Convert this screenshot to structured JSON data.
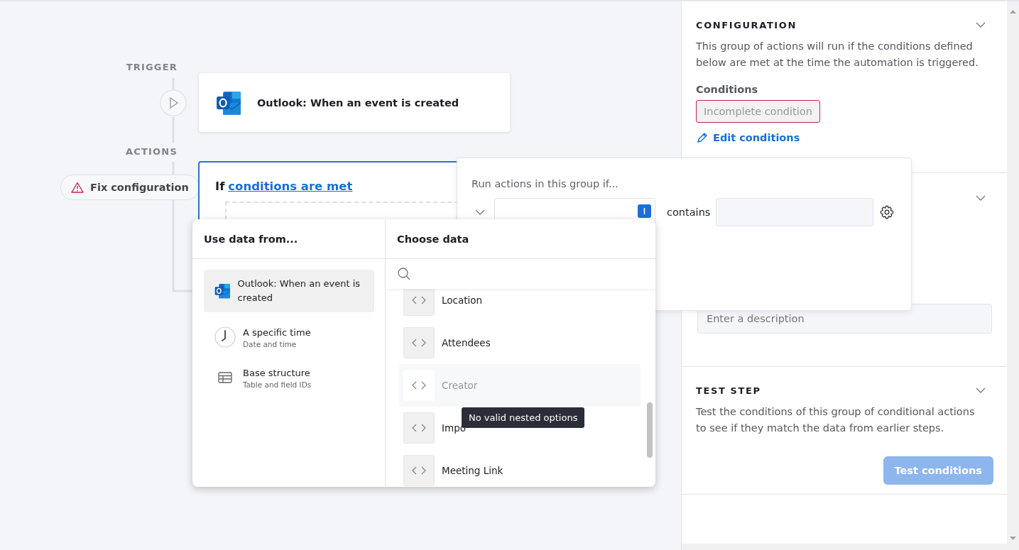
{
  "canvas": {
    "trigger_label": "TRIGGER",
    "trigger": {
      "title": "Outlook: When an event is created"
    },
    "actions_label": "ACTIONS",
    "fix_button": "Fix configuration",
    "condition_card": {
      "prefix": "If",
      "link": "conditions are met"
    }
  },
  "side_panel": {
    "sections": [
      {
        "kind": "config",
        "title": "CONFIGURATION",
        "description": "This group of actions will run if the conditions defined below are met at the time the automation is triggered.",
        "conditions_label": "Conditions",
        "condition_pill": "Incomplete condition",
        "edit_link": "Edit conditions"
      },
      {
        "kind": "details",
        "description_field": {
          "placeholder": "Enter a description"
        }
      },
      {
        "kind": "test",
        "title": "TEST STEP",
        "description": "Test the conditions of this group of conditional actions to see if they match the data from earlier steps.",
        "button": {
          "label": "Test conditions",
          "disabled": true
        }
      }
    ]
  },
  "condition_popover": {
    "heading": "Run actions in this group if...",
    "operator": "contains"
  },
  "data_picker": {
    "sources_heading": "Use data from...",
    "sources": [
      {
        "kind": "outlook",
        "title": "Outlook: When an event is created",
        "selected": true
      },
      {
        "kind": "clock",
        "title": "A specific time",
        "subtitle": "Date and time",
        "selected": false
      },
      {
        "kind": "table",
        "title": "Base structure",
        "subtitle": "Table and field IDs",
        "selected": false
      }
    ],
    "fields_heading": "Choose data",
    "fields": [
      {
        "label": "Location",
        "disabled": false
      },
      {
        "label": "Attendees",
        "disabled": false
      },
      {
        "label": "Creator",
        "disabled": true
      },
      {
        "label": "Impo",
        "disabled": false
      },
      {
        "label": "Meeting Link",
        "disabled": false
      }
    ],
    "tooltip": "No valid nested options"
  }
}
